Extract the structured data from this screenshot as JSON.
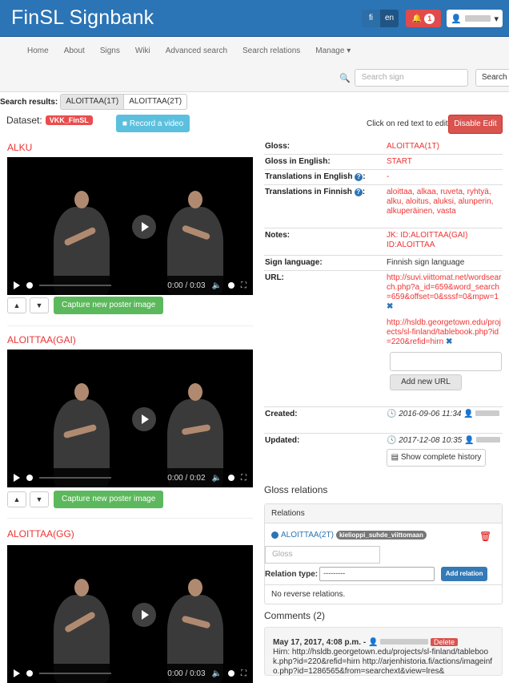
{
  "header": {
    "brand": "FinSL Signbank",
    "lang_fi": "fi",
    "lang_en": "en",
    "notif_count": "1"
  },
  "nav": {
    "items": [
      "Home",
      "About",
      "Signs",
      "Wiki",
      "Advanced search",
      "Search relations",
      "Manage ▾"
    ]
  },
  "search": {
    "placeholder": "Search sign",
    "button": "Search"
  },
  "search_results": {
    "label": "Search results:",
    "items": [
      "ALOITTAA(1T)",
      "ALOITTAA(2T)"
    ]
  },
  "dataset": {
    "label": "Dataset:",
    "value": "VKK_FinSL"
  },
  "record_label": "Record a video",
  "click_hint": "Click on red text to edit",
  "disable_edit": "Disable Edit",
  "videos": [
    {
      "title": "ALKU",
      "time": "0:00 / 0:03"
    },
    {
      "title": "ALOITTAA(GAI)",
      "time": "0:00 / 0:02"
    },
    {
      "title": "ALOITTAA(GG)",
      "time": "0:00 / 0:03"
    }
  ],
  "capture_label": "Capture new poster image",
  "details": {
    "gloss_k": "Gloss:",
    "gloss_v": "ALOITTAA(1T)",
    "gloss_en_k": "Gloss in English:",
    "gloss_en_v": "START",
    "trans_en_k": "Translations in English",
    "trans_en_v": "-",
    "trans_fi_k": "Translations in Finnish",
    "trans_fi_v": "aloittaa, alkaa, ruveta, ryhtyä, alku, aloitus, aluksi, alunperin, alkuperäinen, vasta",
    "notes_k": "Notes:",
    "notes_v": "JK: ID:ALOITTAA(GAI) ID:ALOITTAA",
    "signlang_k": "Sign language:",
    "signlang_v": "Finnish sign language",
    "url_k": "URL:",
    "url1": "http://suvi.viittomat.net/wordsearch.php?a_id=659&word_search=659&offset=0&sssf=0&mpw=1",
    "url2": "http://hsldb.georgetown.edu/projects/sl-finland/tablebook.php?id=220&refid=hirn",
    "add_url": "Add new URL",
    "created_k": "Created:",
    "created_v": "2016-09-06 11:34",
    "updated_k": "Updated:",
    "updated_v": "2017-12-08 10:35",
    "history": "Show complete history"
  },
  "relations": {
    "title": "Gloss relations",
    "panel": "Relations",
    "rel_gloss": "ALOITTAA(2T)",
    "rel_tag": "kielioppi_suhde_viittomaan",
    "gloss_placeholder": "Gloss",
    "type_label": "Relation type:",
    "type_value": "---------",
    "add": "Add relation",
    "noreverse": "No reverse relations."
  },
  "comments": {
    "title": "Comments (2)",
    "date": "May 17, 2017, 4:08 p.m. -",
    "delete": "Delete",
    "text": "Hirn: http://hsldb.georgetown.edu/projects/sl-finland/tablebook.php?id=220&refid=hirn http://arjenhistoria.fi/actions/imageinfo.php?id=1286565&from=searchext&view=lres&"
  }
}
